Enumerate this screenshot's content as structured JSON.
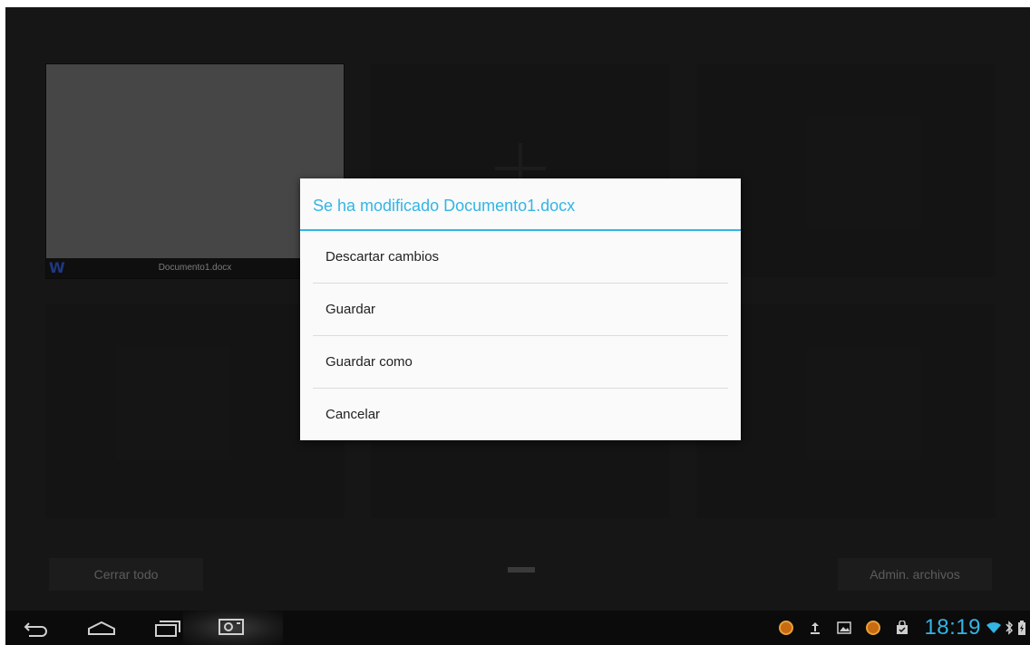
{
  "tiles": {
    "document_name": "Documento1.docx",
    "word_icon_letter": "W"
  },
  "bottom_bar": {
    "close_all_label": "Cerrar todo",
    "file_manager_label": "Admin. archivos"
  },
  "dialog": {
    "title": "Se ha modificado Documento1.docx",
    "options": [
      {
        "label": "Descartar cambios"
      },
      {
        "label": "Guardar"
      },
      {
        "label": "Guardar como"
      },
      {
        "label": "Cancelar"
      }
    ]
  },
  "status_bar": {
    "time": "18:19",
    "accent_color": "#33b5e5",
    "icons": [
      "notification-orange-icon",
      "upload-icon",
      "gallery-icon",
      "notification-orange-icon",
      "shopping-bag-icon",
      "wifi-icon",
      "bluetooth-icon",
      "battery-icon"
    ]
  },
  "nav_bar": {
    "icons": [
      "back-icon",
      "home-icon",
      "recent-apps-icon",
      "screenshot-icon"
    ]
  }
}
